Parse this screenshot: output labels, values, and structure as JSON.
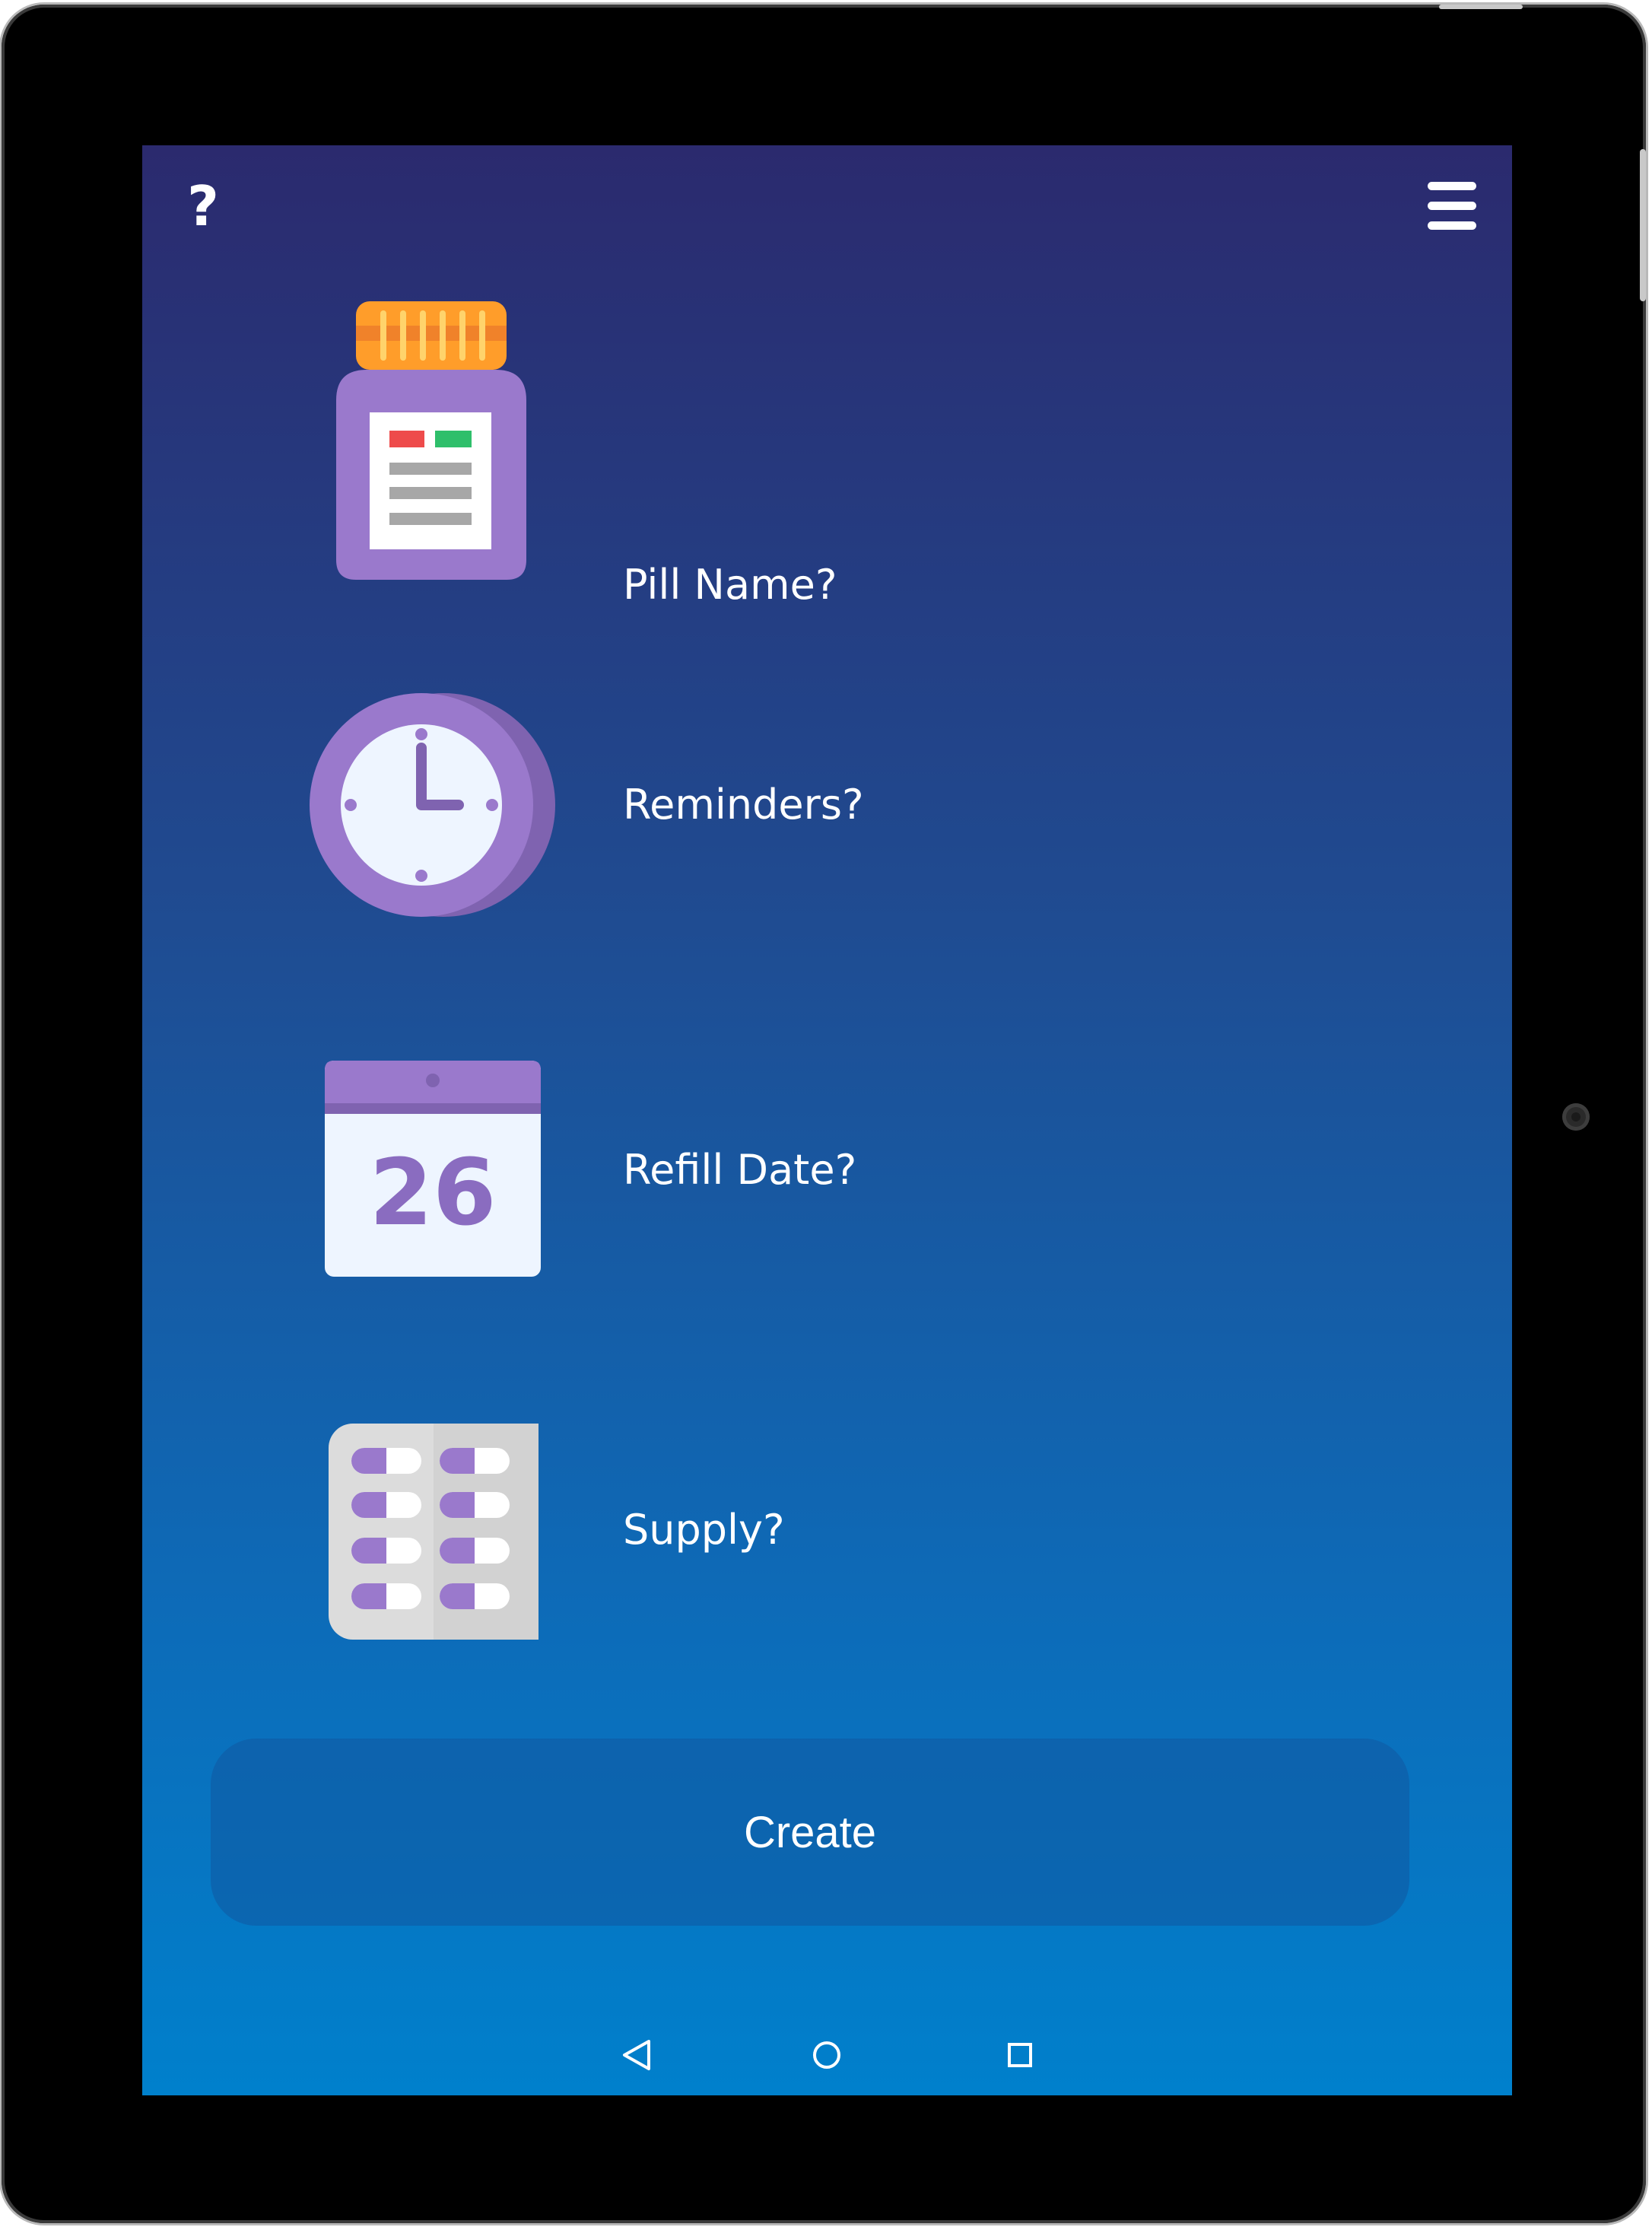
{
  "header": {
    "help_icon": "question-mark-icon",
    "help_glyph": "?",
    "menu_icon": "hamburger-menu-icon"
  },
  "fields": [
    {
      "label": "Pill Name?",
      "icon": "pill-bottle-icon"
    },
    {
      "label": "Reminders?",
      "icon": "clock-icon"
    },
    {
      "label": "Refill Date?",
      "icon": "calendar-icon",
      "calendar_day": "26"
    },
    {
      "label": "Supply?",
      "icon": "pill-blister-pack-icon"
    }
  ],
  "create_button": {
    "label": "Create"
  },
  "navbar": {
    "back_icon": "back-triangle-icon",
    "home_icon": "home-circle-icon",
    "recents_icon": "recents-square-icon"
  },
  "colors": {
    "gradient_top": "#2b2a6e",
    "gradient_bottom": "#0080cc",
    "icon_purple": "#9a79cc",
    "cap_orange": "#ff9d2a"
  }
}
